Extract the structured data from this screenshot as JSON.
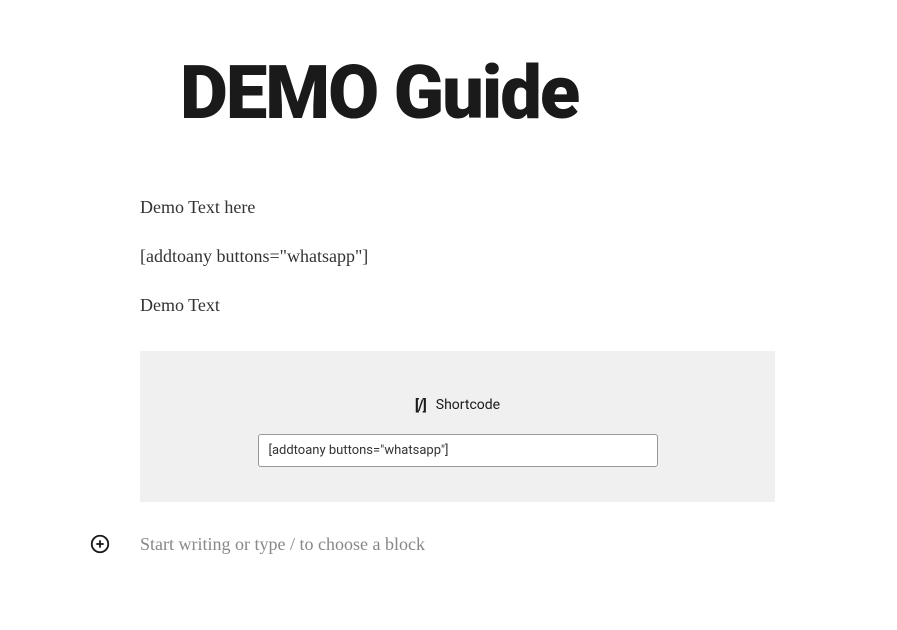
{
  "title": "DEMO Guide",
  "paragraphs": [
    "Demo Text here",
    " [addtoany buttons=\"whatsapp\"]",
    "Demo Text"
  ],
  "shortcode_block": {
    "icon_text": "[/]",
    "label": "Shortcode",
    "input_value": "[addtoany buttons=\"whatsapp\"]"
  },
  "new_block": {
    "placeholder": "Start writing or type / to choose a block"
  }
}
